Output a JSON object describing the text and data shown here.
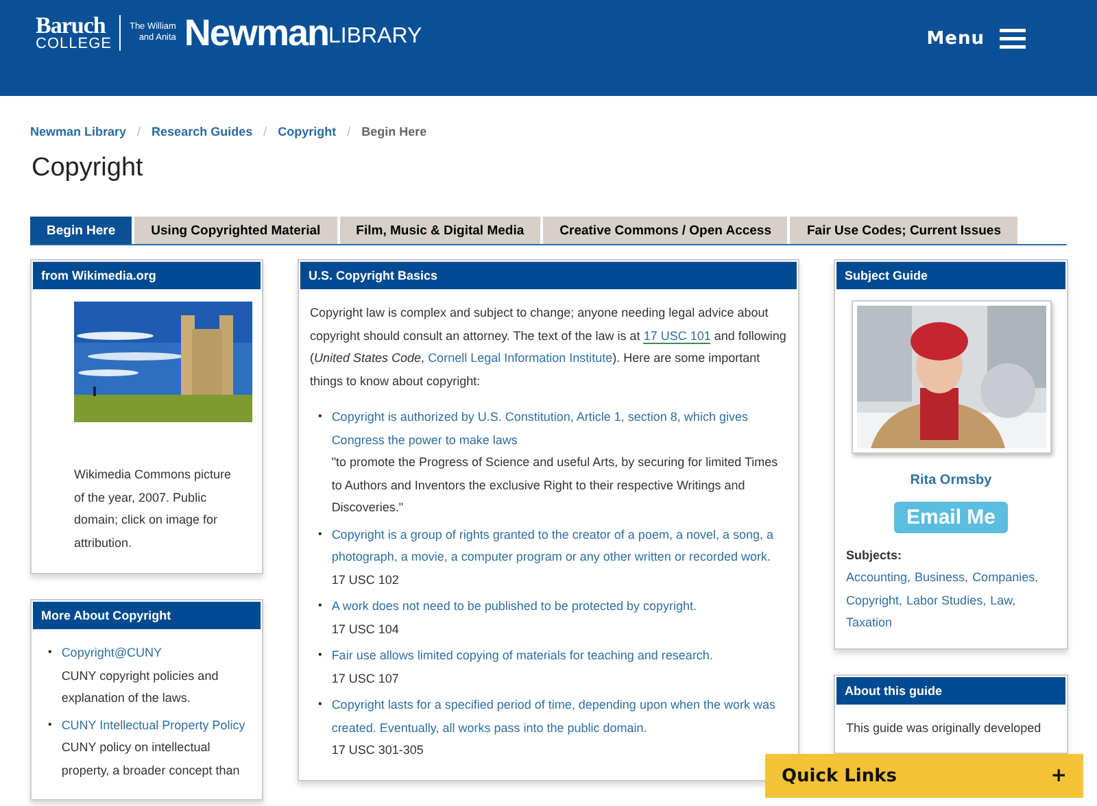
{
  "header": {
    "logo": {
      "college_top": "Baruch",
      "college_bottom": "COLLEGE",
      "dedication_top": "The William",
      "dedication_bottom": "and Anita",
      "name": "Newman",
      "suffix": "LIBRARY"
    },
    "menu_label": "Menu"
  },
  "breadcrumbs": [
    {
      "label": "Newman Library",
      "kind": "link"
    },
    {
      "sep": "/",
      "label": "Research Guides",
      "kind": "link"
    },
    {
      "sep": "/",
      "label": "Copyright",
      "kind": "link"
    },
    {
      "sep": "/",
      "label": "Begin Here",
      "kind": "current"
    }
  ],
  "title": "Copyright",
  "tabs": [
    {
      "label": "Begin Here",
      "selected": true
    },
    {
      "label": "Using Copyrighted Material",
      "selected": false
    },
    {
      "label": "Film, Music & Digital Media",
      "selected": false
    },
    {
      "label": "Creative Commons / Open Access",
      "selected": false
    },
    {
      "label": "Fair Use Codes; Current Issues",
      "selected": false
    }
  ],
  "left_panels": [
    {
      "title": "from Wikimedia.org",
      "caption": "Wikimedia Commons picture of the year, 2007.  Public domain; click on image for attribution."
    },
    {
      "title": "More About Copyright",
      "kind": "links",
      "items": [
        {
          "bullet": "•",
          "link": "Copyright@CUNY",
          "note": "CUNY copyright policies and explanation of the laws."
        },
        {
          "bullet": "•",
          "link": "CUNY Intellectual Property Policy",
          "note": "CUNY policy on intellectual property, a broader concept than"
        }
      ]
    }
  ],
  "basics": {
    "title": "U.S. Copyright Basics",
    "intro": [
      {
        "kind": "text",
        "text": "Copyright law is complex and subject to change; anyone needing legal advice about copyright should consult an attorney.  The text of the law is at "
      },
      {
        "kind": "link",
        "text": "17 USC 101"
      },
      {
        "kind": "text",
        "text": " and following (*United States Code*, "
      },
      {
        "kind": "link",
        "text": "Cornell Legal Information Institute"
      },
      {
        "kind": "text",
        "text": ").  Here are some important things to know about copyright:"
      }
    ],
    "items": [
      {
        "bullet": "•",
        "link": "Copyright is authorized by U.S. Constitution, Article 1, section 8, which gives Congress the power to make laws",
        "note": "\"to promote the Progress of Science and useful Arts, by securing for limited Times to Authors and Inventors the exclusive Right to their respective Writings and Discoveries.\""
      },
      {
        "bullet": "•",
        "link": "Copyright is a group of rights granted to the creator of a poem, a novel, a song, a photograph, a movie, a computer program or any other written or recorded work.",
        "note": "17 USC 102"
      },
      {
        "bullet": "•",
        "link": "A work does not need to be published to be protected by copyright.",
        "note": "17 USC 104"
      },
      {
        "bullet": "•",
        "link": "Fair use allows limited copying of materials for teaching and research.",
        "note": "17 USC 107"
      },
      {
        "bullet": "•",
        "link": "Copyright lasts for a specified period of time, depending upon when the work was created. Eventually, all works pass into the public domain.",
        "note": "17 USC 301-305"
      }
    ]
  },
  "subject_guide": {
    "title": "Subject Guide",
    "name": "Rita Ormsby",
    "email_button": "Email Me",
    "subjects_label": "Subjects:",
    "subjects": [
      "Accounting,",
      "Business,",
      "Companies,",
      "Copyright,",
      "Labor Studies,",
      "Law,",
      "Taxation"
    ]
  },
  "about": {
    "title": "About this guide",
    "text": "This guide was originally developed"
  },
  "quick_links": {
    "label": "Quick Links",
    "toggle": "+"
  }
}
